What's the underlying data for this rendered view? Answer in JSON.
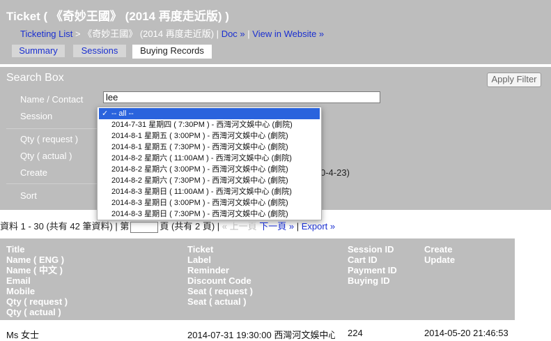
{
  "header": {
    "title": "Ticket ( 《奇妙王國》 (2014 再度走近版) )",
    "breadcrumb": {
      "ticketing_list": "Ticketing List",
      "arrow": ">",
      "current": "《奇妙王國》 (2014 再度走近版)",
      "sep1": "|",
      "doc": "Doc »",
      "sep2": "|",
      "view_website": "View in Website »"
    },
    "tabs": [
      {
        "label": "Summary",
        "active": false
      },
      {
        "label": "Sessions",
        "active": false
      },
      {
        "label": "Buying Records",
        "active": true
      }
    ]
  },
  "search_box": {
    "title": "Search Box",
    "apply_filter": "Apply Filter",
    "fields": {
      "name_contact_label": "Name / Contact",
      "name_contact_value": "lee",
      "session_label": "Session",
      "qty_request_label": "Qty ( request )",
      "qty_actual_label": "Qty ( actual )",
      "create_label": "Create",
      "create_tail": "0-4-23)",
      "sort_label": "Sort"
    },
    "session_dropdown": {
      "selected_index": 0,
      "check": "✓",
      "options": [
        "-- all --",
        "2014-7-31 星期四 ( 7:30PM ) - 西灣河文娛中心 (劇院)",
        "2014-8-1 星期五 ( 3:00PM ) - 西灣河文娛中心 (劇院)",
        "2014-8-1 星期五 ( 7:30PM ) - 西灣河文娛中心 (劇院)",
        "2014-8-2 星期六 ( 11:00AM ) - 西灣河文娛中心 (劇院)",
        "2014-8-2 星期六 ( 3:00PM ) - 西灣河文娛中心 (劇院)",
        "2014-8-2 星期六 ( 7:30PM ) - 西灣河文娛中心 (劇院)",
        "2014-8-3 星期日 ( 11:00AM ) - 西灣河文娛中心 (劇院)",
        "2014-8-3 星期日 ( 3:00PM ) - 西灣河文娛中心 (劇院)",
        "2014-8-3 星期日 ( 7:30PM ) - 西灣河文娛中心 (劇院)"
      ]
    }
  },
  "pager": {
    "range": "資料 1 - 30 (共有 42 筆資料) | 第",
    "of_pages": "頁 (共有 2 頁) |",
    "prev": "« 上一頁",
    "next": "下一頁 »",
    "export": "Export »"
  },
  "table": {
    "columns": [
      [
        "Title",
        "Name ( ENG )",
        "Name ( 中文 )",
        "Email",
        "Mobile",
        "Qty ( request )",
        "Qty ( actual )"
      ],
      [
        "Ticket",
        "Label",
        "Reminder",
        "Discount Code",
        "Seat ( request )",
        "Seat ( actual )"
      ],
      [
        "Session ID",
        "Cart ID",
        "Payment ID",
        "Buying ID"
      ],
      [
        "Create",
        "Update"
      ]
    ],
    "first_row": {
      "title": "Ms 女士",
      "ticket": "2014-07-31 19:30:00 西灣河文娛中心",
      "session_id": "224",
      "create": "2014-05-20 21:46:53"
    }
  }
}
